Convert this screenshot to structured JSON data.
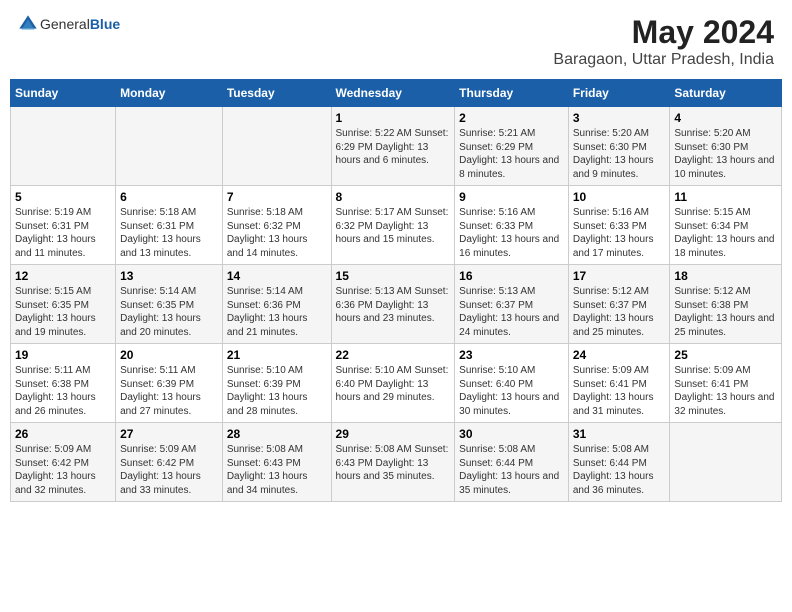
{
  "header": {
    "logo_general": "General",
    "logo_blue": "Blue",
    "title": "May 2024",
    "subtitle": "Baragaon, Uttar Pradesh, India"
  },
  "weekdays": [
    "Sunday",
    "Monday",
    "Tuesday",
    "Wednesday",
    "Thursday",
    "Friday",
    "Saturday"
  ],
  "weeks": [
    [
      {
        "day": "",
        "detail": ""
      },
      {
        "day": "",
        "detail": ""
      },
      {
        "day": "",
        "detail": ""
      },
      {
        "day": "1",
        "detail": "Sunrise: 5:22 AM\nSunset: 6:29 PM\nDaylight: 13 hours and 6 minutes."
      },
      {
        "day": "2",
        "detail": "Sunrise: 5:21 AM\nSunset: 6:29 PM\nDaylight: 13 hours and 8 minutes."
      },
      {
        "day": "3",
        "detail": "Sunrise: 5:20 AM\nSunset: 6:30 PM\nDaylight: 13 hours and 9 minutes."
      },
      {
        "day": "4",
        "detail": "Sunrise: 5:20 AM\nSunset: 6:30 PM\nDaylight: 13 hours and 10 minutes."
      }
    ],
    [
      {
        "day": "5",
        "detail": "Sunrise: 5:19 AM\nSunset: 6:31 PM\nDaylight: 13 hours and 11 minutes."
      },
      {
        "day": "6",
        "detail": "Sunrise: 5:18 AM\nSunset: 6:31 PM\nDaylight: 13 hours and 13 minutes."
      },
      {
        "day": "7",
        "detail": "Sunrise: 5:18 AM\nSunset: 6:32 PM\nDaylight: 13 hours and 14 minutes."
      },
      {
        "day": "8",
        "detail": "Sunrise: 5:17 AM\nSunset: 6:32 PM\nDaylight: 13 hours and 15 minutes."
      },
      {
        "day": "9",
        "detail": "Sunrise: 5:16 AM\nSunset: 6:33 PM\nDaylight: 13 hours and 16 minutes."
      },
      {
        "day": "10",
        "detail": "Sunrise: 5:16 AM\nSunset: 6:33 PM\nDaylight: 13 hours and 17 minutes."
      },
      {
        "day": "11",
        "detail": "Sunrise: 5:15 AM\nSunset: 6:34 PM\nDaylight: 13 hours and 18 minutes."
      }
    ],
    [
      {
        "day": "12",
        "detail": "Sunrise: 5:15 AM\nSunset: 6:35 PM\nDaylight: 13 hours and 19 minutes."
      },
      {
        "day": "13",
        "detail": "Sunrise: 5:14 AM\nSunset: 6:35 PM\nDaylight: 13 hours and 20 minutes."
      },
      {
        "day": "14",
        "detail": "Sunrise: 5:14 AM\nSunset: 6:36 PM\nDaylight: 13 hours and 21 minutes."
      },
      {
        "day": "15",
        "detail": "Sunrise: 5:13 AM\nSunset: 6:36 PM\nDaylight: 13 hours and 23 minutes."
      },
      {
        "day": "16",
        "detail": "Sunrise: 5:13 AM\nSunset: 6:37 PM\nDaylight: 13 hours and 24 minutes."
      },
      {
        "day": "17",
        "detail": "Sunrise: 5:12 AM\nSunset: 6:37 PM\nDaylight: 13 hours and 25 minutes."
      },
      {
        "day": "18",
        "detail": "Sunrise: 5:12 AM\nSunset: 6:38 PM\nDaylight: 13 hours and 25 minutes."
      }
    ],
    [
      {
        "day": "19",
        "detail": "Sunrise: 5:11 AM\nSunset: 6:38 PM\nDaylight: 13 hours and 26 minutes."
      },
      {
        "day": "20",
        "detail": "Sunrise: 5:11 AM\nSunset: 6:39 PM\nDaylight: 13 hours and 27 minutes."
      },
      {
        "day": "21",
        "detail": "Sunrise: 5:10 AM\nSunset: 6:39 PM\nDaylight: 13 hours and 28 minutes."
      },
      {
        "day": "22",
        "detail": "Sunrise: 5:10 AM\nSunset: 6:40 PM\nDaylight: 13 hours and 29 minutes."
      },
      {
        "day": "23",
        "detail": "Sunrise: 5:10 AM\nSunset: 6:40 PM\nDaylight: 13 hours and 30 minutes."
      },
      {
        "day": "24",
        "detail": "Sunrise: 5:09 AM\nSunset: 6:41 PM\nDaylight: 13 hours and 31 minutes."
      },
      {
        "day": "25",
        "detail": "Sunrise: 5:09 AM\nSunset: 6:41 PM\nDaylight: 13 hours and 32 minutes."
      }
    ],
    [
      {
        "day": "26",
        "detail": "Sunrise: 5:09 AM\nSunset: 6:42 PM\nDaylight: 13 hours and 32 minutes."
      },
      {
        "day": "27",
        "detail": "Sunrise: 5:09 AM\nSunset: 6:42 PM\nDaylight: 13 hours and 33 minutes."
      },
      {
        "day": "28",
        "detail": "Sunrise: 5:08 AM\nSunset: 6:43 PM\nDaylight: 13 hours and 34 minutes."
      },
      {
        "day": "29",
        "detail": "Sunrise: 5:08 AM\nSunset: 6:43 PM\nDaylight: 13 hours and 35 minutes."
      },
      {
        "day": "30",
        "detail": "Sunrise: 5:08 AM\nSunset: 6:44 PM\nDaylight: 13 hours and 35 minutes."
      },
      {
        "day": "31",
        "detail": "Sunrise: 5:08 AM\nSunset: 6:44 PM\nDaylight: 13 hours and 36 minutes."
      },
      {
        "day": "",
        "detail": ""
      }
    ]
  ]
}
